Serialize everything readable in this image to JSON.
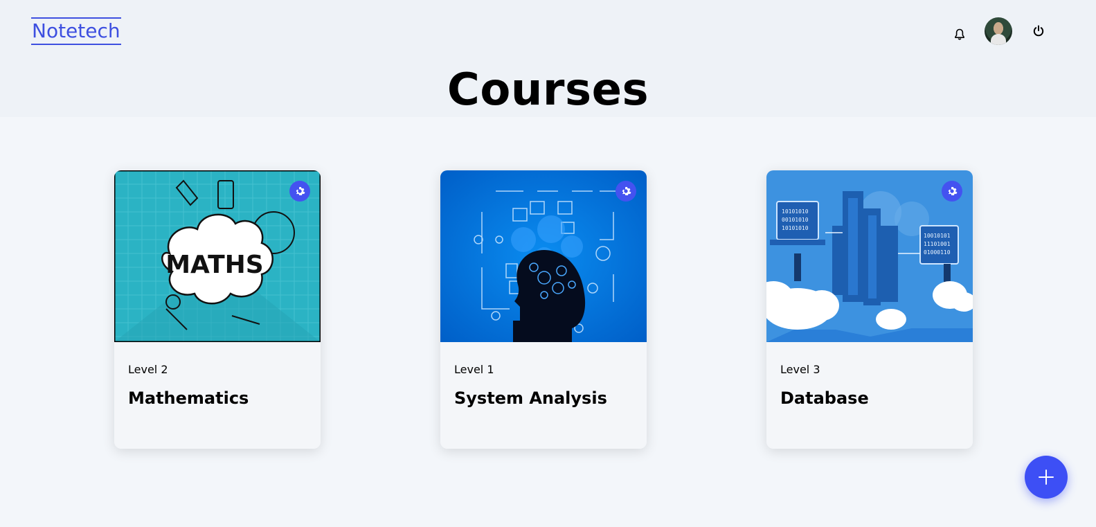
{
  "header": {
    "logo": "Notetech",
    "icons": [
      "bell-icon",
      "avatar",
      "power-icon"
    ]
  },
  "page_title": "Courses",
  "courses": [
    {
      "level": "Level 2",
      "name": "Mathematics",
      "image_text": "MATHS",
      "image": "maths-illustration"
    },
    {
      "level": "Level 1",
      "name": "System Analysis",
      "image": "system-analysis-illustration"
    },
    {
      "level": "Level 3",
      "name": "Database",
      "image": "database-cloud-illustration"
    }
  ],
  "actions": {
    "settings_icon": "gear-icon",
    "add_icon": "plus-icon"
  },
  "colors": {
    "accent": "#3d4ff5",
    "logo": "#3d4fe0",
    "header_bg": "#eef2f7",
    "page_bg": "#f3f6fa"
  }
}
